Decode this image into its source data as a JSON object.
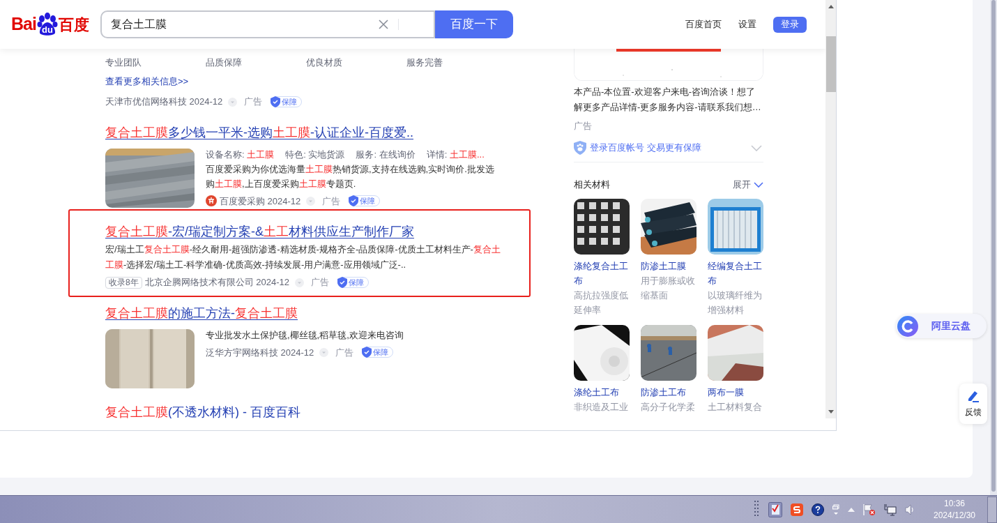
{
  "header": {
    "logo": {
      "latin": "Bai",
      "paw": "du",
      "cjk": "百度"
    },
    "search": {
      "value": "复合土工膜"
    },
    "search_button": "百度一下",
    "links": [
      "百度首页",
      "设置"
    ],
    "login_button": "登录"
  },
  "results": [
    {
      "kind": "partial",
      "outlined": false,
      "tags": [
        "专业团队",
        "品质保障",
        "优良材质",
        "服务完善"
      ],
      "more_link": "查看更多相关信息>>",
      "source": {
        "name": "天津市优信网络科技 2024-12",
        "ad": "广告",
        "badge": "保障"
      }
    },
    {
      "outlined": false,
      "title": [
        {
          "text": "复合土工膜",
          "highlight": true
        },
        {
          "text": "多少钱一平米-选购",
          "highlight": false
        },
        {
          "text": "土工膜",
          "highlight": true
        },
        {
          "text": "-认证企业-百度爱..",
          "highlight": false
        }
      ],
      "fields": [
        {
          "label": "设备名称:",
          "value": "土工膜",
          "highlight": true
        },
        {
          "label": "特色:",
          "value": "实地货源",
          "highlight": false
        },
        {
          "label": "服务:",
          "value": "在线询价",
          "highlight": false
        },
        {
          "label": "详情:",
          "value": "土工膜...",
          "highlight": true
        }
      ],
      "snippet": [
        {
          "text": "百度爱采购为你优选海量",
          "highlight": false
        },
        {
          "text": "土工膜",
          "highlight": true
        },
        {
          "text": "热销货源,支持在线选购,实时询价.批发选购",
          "highlight": false
        },
        {
          "text": "土工膜",
          "highlight": true
        },
        {
          "text": ",上百度爱采购",
          "highlight": false
        },
        {
          "text": "土工膜",
          "highlight": true
        },
        {
          "text": "专题页.",
          "highlight": false
        }
      ],
      "source": {
        "logo": true,
        "name": "百度爱采购 2024-12",
        "ad": "广告",
        "badge": "保障"
      }
    },
    {
      "kind": "text",
      "outlined": true,
      "title": [
        {
          "text": "复合土工膜",
          "highlight": true
        },
        {
          "text": "-宏/瑞定制方案-&",
          "highlight": false
        },
        {
          "text": "土工",
          "highlight": true
        },
        {
          "text": "材料供应生产制作厂家",
          "highlight": false
        }
      ],
      "snippet": [
        {
          "text": "宏/瑞土工",
          "highlight": false
        },
        {
          "text": "复合土工膜",
          "highlight": true
        },
        {
          "text": "-经久耐用-超强防渗透-精选材质-规格齐全-品质保障-优质土工材料生产-",
          "highlight": false
        },
        {
          "text": "复合土工膜",
          "highlight": true
        },
        {
          "text": "-选择宏/瑞土工-科学准确-优质高效-持续发展-用户满意-应用领域广泛-..",
          "highlight": false
        }
      ],
      "source": {
        "age_tag": "收录8年",
        "name": "北京企腾网络技术有限公司 2024-12",
        "ad": "广告",
        "badge": "保障"
      }
    },
    {
      "outlined": false,
      "title": [
        {
          "text": "复合土工膜",
          "highlight": true
        },
        {
          "text": "的施工方法-",
          "highlight": false
        },
        {
          "text": "复合土工膜",
          "highlight": true
        }
      ],
      "snippet": [
        {
          "text": "专业批发水土保护毯,椰丝毯,稻草毯,欢迎来电咨询",
          "highlight": false
        }
      ],
      "source": {
        "name": "泛华方宇网络科技 2024-12",
        "ad": "广告",
        "badge": "保障"
      }
    },
    {
      "kind": "title",
      "outlined": false,
      "title": [
        {
          "text": "复合土工膜",
          "highlight": true
        },
        {
          "text": "(不透水材料) - 百度百科",
          "highlight": false
        }
      ]
    }
  ],
  "sidebar": {
    "ad": {
      "text": "本产品-本位置-欢迎客户来电-咨询洽谈！想了解更多产品详情-更多服务内容-请联系我们想…",
      "label": "广告",
      "login_prompt": "登录百度帐号 交易更有保障"
    },
    "related": {
      "title": "相关材料",
      "expand": "展开",
      "items": [
        {
          "name": "涤纶复合土工布",
          "desc": "高抗拉强度低延伸率"
        },
        {
          "name": "防渗土工膜",
          "desc": "用于膨胀或收缩基面"
        },
        {
          "name": "经编复合土工布",
          "desc": "以玻璃纤维为增强材料"
        },
        {
          "name": "涤纶土工布",
          "desc": "非织造及工业"
        },
        {
          "name": "防渗土工布",
          "desc": "高分子化学柔"
        },
        {
          "name": "两布一膜",
          "desc": "土工材料复合"
        }
      ]
    }
  },
  "floating": {
    "cloud_drive": "阿里云盘",
    "feedback": "反馈"
  },
  "taskbar": {
    "time": "10:36",
    "date": "2024/12/30"
  }
}
